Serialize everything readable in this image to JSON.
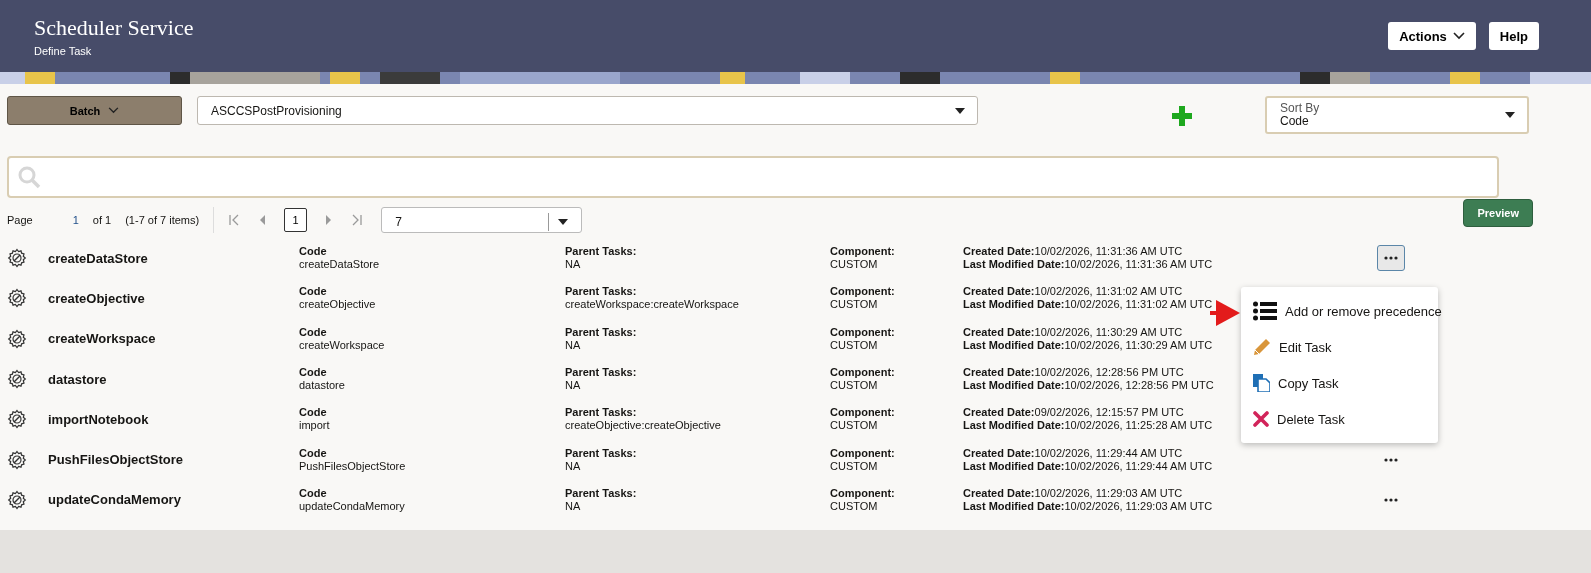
{
  "header": {
    "title": "Scheduler Service",
    "subtitle": "Define Task",
    "buttons": [
      {
        "label": "Actions",
        "dropdown": true
      },
      {
        "label": "Help",
        "dropdown": false
      }
    ]
  },
  "toolbar": {
    "batch_button": "Batch",
    "batch_select": {
      "value": "ASCCSPostProvisioning"
    },
    "sort": {
      "label": "Sort By",
      "value": "Code"
    }
  },
  "pagination": {
    "page_label": "Page",
    "page_value": "1",
    "of_total": "of 1",
    "range": "(1-7 of 7 items)",
    "pages": [
      {
        "label": "1",
        "selected": true
      }
    ],
    "page_size": "7",
    "preview_button": "Preview"
  },
  "tasks": [
    {
      "name": "createDataStore",
      "code_label": "Code",
      "code": "createDataStore",
      "parent_label": "Parent Tasks:",
      "parent": "NA",
      "component_label": "Component:",
      "component": "CUSTOM",
      "created_label": "Created Date:",
      "created": "10/02/2026, 11:31:36 AM UTC",
      "modified_label": "Last Modified Date:",
      "modified": "10/02/2026, 11:31:36 AM UTC",
      "more_button": {
        "selected": true
      }
    },
    {
      "name": "createObjective",
      "code_label": "Code",
      "code": "createObjective",
      "parent_label": "Parent Tasks:",
      "parent": "createWorkspace:createWorkspace",
      "component_label": "Component:",
      "component": "CUSTOM",
      "created_label": "Created Date:",
      "created": "10/02/2026, 11:31:02 AM UTC",
      "modified_label": "Last Modified Date:",
      "modified": "10/02/2026, 11:31:02 AM UTC"
    },
    {
      "name": "createWorkspace",
      "code_label": "Code",
      "code": "createWorkspace",
      "parent_label": "Parent Tasks:",
      "parent": "NA",
      "component_label": "Component:",
      "component": "CUSTOM",
      "created_label": "Created Date:",
      "created": "10/02/2026, 11:30:29 AM UTC",
      "modified_label": "Last Modified Date:",
      "modified": "10/02/2026, 11:30:29 AM UTC"
    },
    {
      "name": "datastore",
      "code_label": "Code",
      "code": "datastore",
      "parent_label": "Parent Tasks:",
      "parent": "NA",
      "component_label": "Component:",
      "component": "CUSTOM",
      "created_label": "Created Date:",
      "created": "10/02/2026, 12:28:56 PM UTC",
      "modified_label": "Last Modified Date:",
      "modified": "10/02/2026, 12:28:56 PM UTC"
    },
    {
      "name": "importNotebook",
      "code_label": "Code",
      "code": "import",
      "parent_label": "Parent Tasks:",
      "parent": "createObjective:createObjective",
      "component_label": "Component:",
      "component": "CUSTOM",
      "created_label": "Created Date:",
      "created": "09/02/2026, 12:15:57 PM UTC",
      "modified_label": "Last Modified Date:",
      "modified": "10/02/2026, 11:25:28 AM UTC"
    },
    {
      "name": "PushFilesObjectStore",
      "code_label": "Code",
      "code": "PushFilesObjectStore",
      "parent_label": "Parent Tasks:",
      "parent": "NA",
      "component_label": "Component:",
      "component": "CUSTOM",
      "created_label": "Created Date:",
      "created": "10/02/2026, 11:29:44 AM UTC",
      "modified_label": "Last Modified Date:",
      "modified": "10/02/2026, 11:29:44 AM UTC",
      "more_button": {
        "selected": false
      }
    },
    {
      "name": "updateCondaMemory",
      "code_label": "Code",
      "code": "updateCondaMemory",
      "parent_label": "Parent Tasks:",
      "parent": "NA",
      "component_label": "Component:",
      "component": "CUSTOM",
      "created_label": "Created Date:",
      "created": "10/02/2026, 11:29:03 AM UTC",
      "modified_label": "Last Modified Date:",
      "modified": "10/02/2026, 11:29:03 AM UTC",
      "more_button": {
        "selected": false
      }
    }
  ],
  "context_menu": {
    "items": [
      {
        "kind": "precedence",
        "label": "Add or remove precedence"
      },
      {
        "kind": "edit",
        "label": "Edit Task"
      },
      {
        "kind": "copy",
        "label": "Copy Task"
      },
      {
        "kind": "delete",
        "label": "Delete Task"
      }
    ]
  },
  "annotation": {
    "kind": "arrow"
  }
}
